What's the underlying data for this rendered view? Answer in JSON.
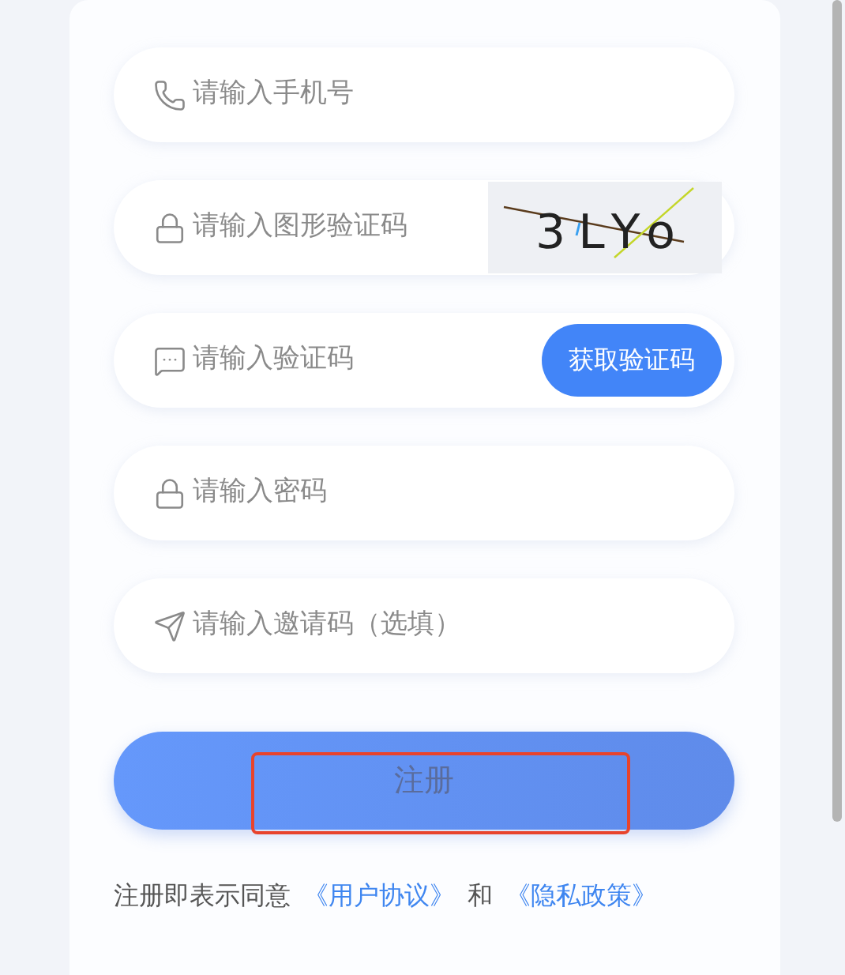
{
  "fields": [
    {
      "kind": "phone",
      "placeholder": "请输入手机号"
    },
    {
      "kind": "captcha",
      "placeholder": "请输入图形验证码",
      "captcha": "3LYo"
    },
    {
      "kind": "sms",
      "placeholder": "请输入验证码",
      "button": "获取验证码"
    },
    {
      "kind": "password",
      "placeholder": "请输入密码"
    },
    {
      "kind": "invite",
      "placeholder": "请输入邀请码（选填）"
    }
  ],
  "submit": {
    "label": "注册",
    "highlighted": true
  },
  "agreement": {
    "text": "注册即表示同意",
    "link_1": "《用户协议》",
    "joiner": "和",
    "link_2": "《隐私政策》"
  }
}
